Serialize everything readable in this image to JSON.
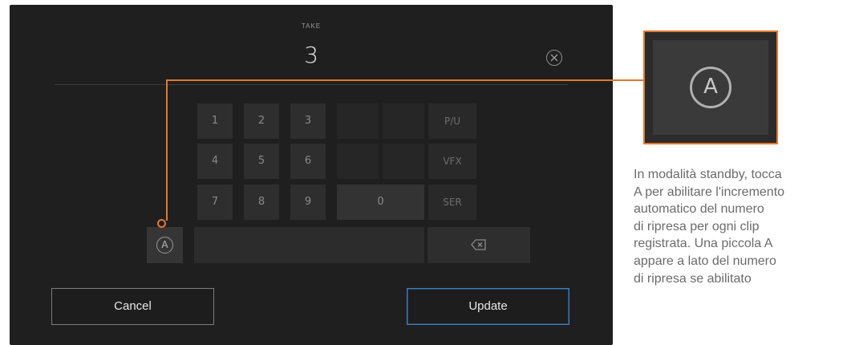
{
  "header": {
    "label": "TAKE",
    "value": "3"
  },
  "keypad": {
    "digits": [
      "1",
      "2",
      "3",
      "4",
      "5",
      "6",
      "7",
      "8",
      "9"
    ],
    "zero": "0",
    "suffixes": [
      "P/U",
      "VFX",
      "SER"
    ]
  },
  "buttons": {
    "cancel": "Cancel",
    "update": "Update"
  },
  "zoom": {
    "glyph": "A"
  },
  "caption": {
    "lines": [
      "In modalità standby, tocca",
      "A per abilitare l'incremento",
      "automatico del numero",
      "di ripresa per ogni clip",
      "registrata. Una piccola A",
      "appare a lato del numero",
      "di ripresa se abilitato"
    ]
  },
  "colors": {
    "accent": "#e2782e",
    "update_border": "#3f7ec0",
    "panel": "#1f1f1f"
  },
  "icons": [
    "clear-icon",
    "auto-increment-icon",
    "backspace-icon"
  ]
}
